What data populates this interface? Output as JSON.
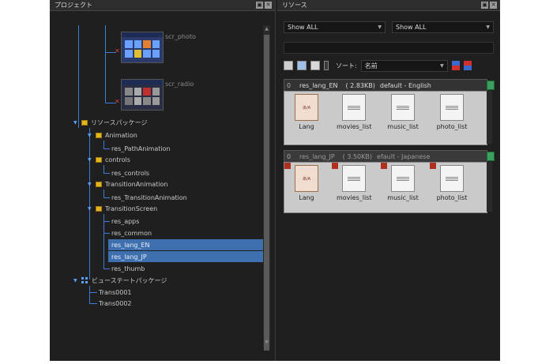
{
  "left_panel": {
    "title": "プロジェクト",
    "buttons": [
      "▣",
      "✕"
    ],
    "screens": [
      {
        "label": "scr_photo"
      },
      {
        "label": "scr_radio"
      }
    ],
    "tree": {
      "resource_packages": "リソースパッケージ",
      "groups": [
        {
          "label": "Animation",
          "children": [
            "res_PathAnimation"
          ]
        },
        {
          "label": "controls",
          "children": [
            "res_controls"
          ]
        },
        {
          "label": "TransitionAnimation",
          "children": [
            "res_TransitionAnimation"
          ]
        },
        {
          "label": "TransitionScreen",
          "children": [
            "res_apps",
            "res_common",
            "res_lang_EN",
            "res_lang_JP",
            "res_thumb"
          ]
        }
      ],
      "view_state_packages": "ビューステートパッケージ",
      "view_states": [
        "Trans0001",
        "Trans0002"
      ]
    }
  },
  "right_panel": {
    "title": "リソース",
    "buttons": [
      "▣",
      "✕"
    ],
    "filter_left": "Show ALL",
    "filter_right": "Show ALL",
    "sort_label": "ソート:",
    "sort_value": "名前",
    "groups": [
      {
        "num": "0",
        "name": "res_lang_EN",
        "size": "( 2.83KB)",
        "desc": "default - English",
        "files": [
          {
            "label": "Lang",
            "icon": "あ/A\nLANG\n.RDO",
            "type": "lang"
          },
          {
            "label": "movies_list",
            "icon": "MODEL\n.CVR",
            "type": "model"
          },
          {
            "label": "music_list",
            "icon": "MODEL\n.CVR",
            "type": "model"
          },
          {
            "label": "photo_list",
            "icon": "MODEL\n.CVR",
            "type": "model"
          }
        ]
      },
      {
        "num": "0",
        "name": "res_lang_JP",
        "size": "( 3.50KB)",
        "desc": "efault - Japanese",
        "files": [
          {
            "label": "Lang",
            "icon": "あ/A\nLANG\n.RDO",
            "type": "lang"
          },
          {
            "label": "movies_list",
            "icon": "MODEL\n.CVR",
            "type": "model"
          },
          {
            "label": "music_list",
            "icon": "MODEL\n.CVR",
            "type": "model"
          },
          {
            "label": "photo_list",
            "icon": "MODEL\n.CVR",
            "type": "model"
          }
        ]
      }
    ]
  },
  "colors": {
    "tree_line": "#3a7bd5",
    "selection": "#3e6fae",
    "folder": "#e3b320",
    "badge": "#3aa060",
    "red_marker": "#b03020"
  }
}
